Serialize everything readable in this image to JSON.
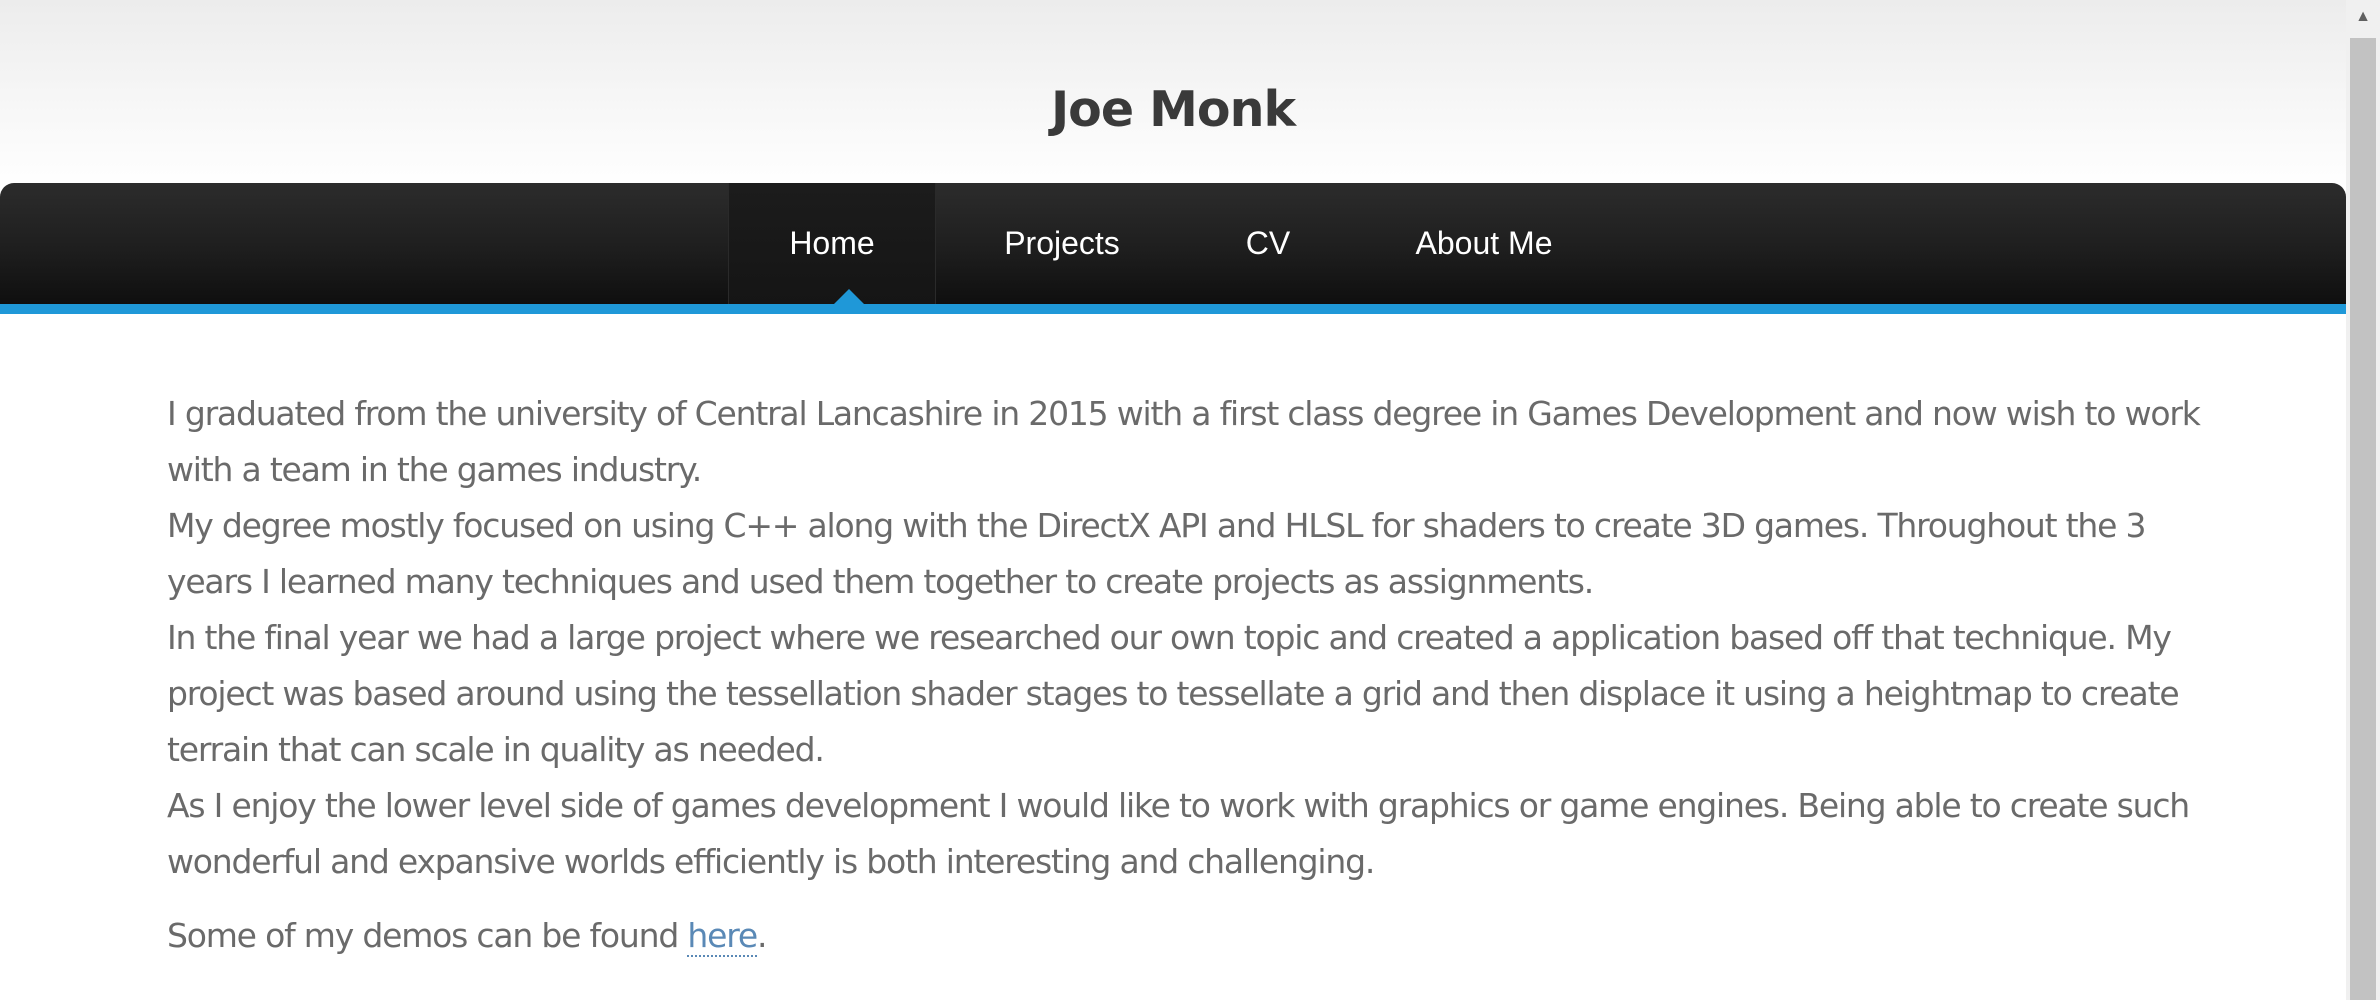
{
  "site": {
    "title": "Joe Monk"
  },
  "nav": {
    "items": [
      {
        "label": "Home",
        "active": true
      },
      {
        "label": "Projects",
        "active": false
      },
      {
        "label": "CV",
        "active": false
      },
      {
        "label": "About Me",
        "active": false
      }
    ]
  },
  "content": {
    "paragraphs": [
      "I graduated from the university of Central Lancashire in 2015 with a first class degree in Games Development and now wish to work with a team in the games industry.",
      "My degree mostly focused on using C++ along with the DirectX API and HLSL for shaders to create 3D games. Throughout the 3 years I learned many techniques and used them together to create projects as assignments.",
      "In the final year we had a large project where we researched our own topic and created a application based off that technique. My project was based around using the tessellation shader stages to tessellate a grid and then displace it using a heightmap to create terrain that can scale in quality as needed.",
      "As I enjoy the lower level side of games development I would like to work with graphics or game engines. Being able to create such wonderful and expansive worlds efficiently is both interesting and challenging."
    ],
    "demos": {
      "prefix": "Some of my demos can be found ",
      "link": "here",
      "suffix": "."
    }
  },
  "scrollbar": {
    "up_icon": "arrow-up-icon"
  },
  "colors": {
    "accent": "#1f98d8",
    "nav_background": "#1e1e1e",
    "body_text": "#6a6a6a",
    "link": "#5a89b6",
    "title": "#3a3a3a"
  }
}
